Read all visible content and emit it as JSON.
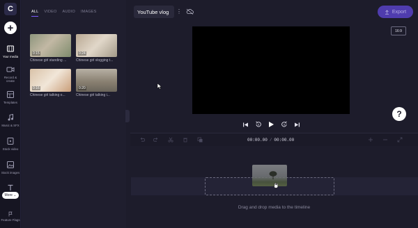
{
  "app": {
    "logo_letter": "C",
    "project_name": "YouTube vlog",
    "kebab": "⋮",
    "export_label": "Export",
    "accent_color": "#7c5cff",
    "export_color": "#4f3cae"
  },
  "rail": {
    "add_symbol": "+",
    "items": [
      {
        "label": "Your media",
        "icon": "film-icon"
      },
      {
        "label": "Record & create",
        "icon": "camera-icon"
      },
      {
        "label": "Templates",
        "icon": "templates-icon"
      },
      {
        "label": "Music & SFX",
        "icon": "music-icon"
      },
      {
        "label": "Stock video",
        "icon": "video-icon"
      },
      {
        "label": "Stock images",
        "icon": "image-icon"
      },
      {
        "label": "Text",
        "icon": "text-icon"
      },
      {
        "label": "Feature Flags",
        "icon": "flag-icon"
      }
    ],
    "more_label": "More"
  },
  "media": {
    "tabs": [
      "ALL",
      "VIDEO",
      "AUDIO",
      "IMAGES"
    ],
    "active_tab": "ALL",
    "clips": [
      {
        "title": "Chinese girl standing ...",
        "duration": "0:15"
      },
      {
        "title": "Chinese girl vlogging t...",
        "duration": "0:24"
      },
      {
        "title": "Chinese girl talking o...",
        "duration": "0:16"
      },
      {
        "title": "Chinese girl talking i...",
        "duration": "0:20"
      }
    ]
  },
  "preview": {
    "aspect_ratio": "16:9",
    "help_label": "?"
  },
  "timeline": {
    "current_time": "00:00.00",
    "total_time": "00:00.00",
    "separator": "/",
    "drop_hint": "Drag and drop media to the timeline"
  }
}
